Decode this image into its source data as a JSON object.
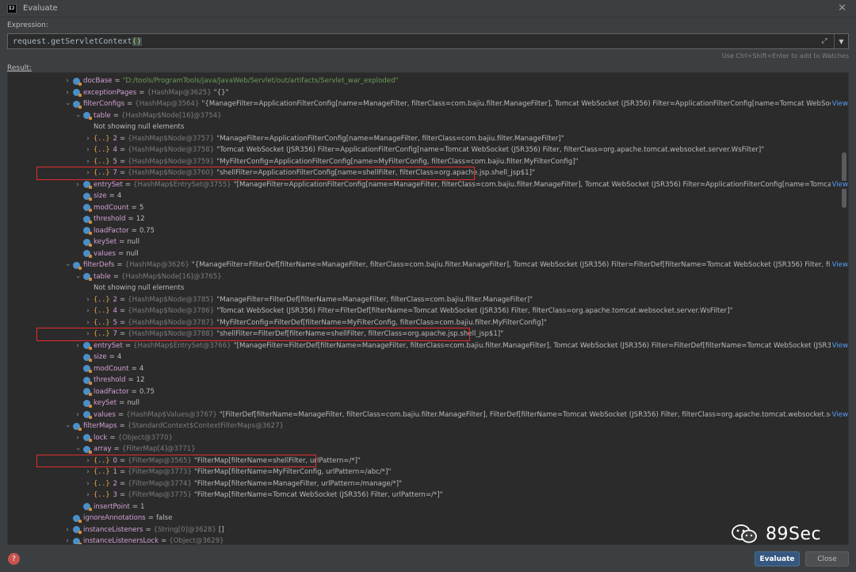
{
  "window": {
    "title": "Evaluate",
    "app_icon": "IJ"
  },
  "expression": {
    "label": "Expression:",
    "prefix": "request.getServletContext",
    "parens": "()",
    "hint": "Use Ctrl+Shift+Enter to add to Watches"
  },
  "result": {
    "label": "Result:"
  },
  "tree": [
    {
      "indent": 0,
      "chev": "closed",
      "icon": "field",
      "name": "docBase",
      "type": "",
      "value": "\"D:/tools/ProgramTools/java/JavaWeb/Servlet/out/artifacts/Servlet_war_exploded\"",
      "str": true
    },
    {
      "indent": 0,
      "chev": "closed",
      "icon": "field",
      "name": "exceptionPages",
      "type": "{HashMap@3625}",
      "value": "\"{}\""
    },
    {
      "indent": 0,
      "chev": "open",
      "icon": "field",
      "name": "filterConfigs",
      "type": "{HashMap@3564}",
      "value": "\"{ManageFilter=ApplicationFilterConfig[name=ManageFilter, filterClass=com.bajiu.filter.ManageFilter], Tomcat WebSocket (JSR356) Filter=ApplicationFilterConfig[name=Tomcat WebSocket ...",
      "view": "View"
    },
    {
      "indent": 1,
      "chev": "open",
      "icon": "field",
      "name": "table",
      "type": "{HashMap$Node[16]@3754}",
      "value": ""
    },
    {
      "indent": 2,
      "chev": "none",
      "icon": "none",
      "name": "Not showing null elements",
      "plain": true,
      "type": "",
      "value": ""
    },
    {
      "indent": 2,
      "chev": "closed",
      "icon": "entry",
      "name": "2",
      "type": "{HashMap$Node@3757}",
      "value": "\"ManageFilter=ApplicationFilterConfig[name=ManageFilter, filterClass=com.bajiu.filter.ManageFilter]\""
    },
    {
      "indent": 2,
      "chev": "closed",
      "icon": "entry",
      "name": "4",
      "type": "{HashMap$Node@3758}",
      "value": "\"Tomcat WebSocket (JSR356) Filter=ApplicationFilterConfig[name=Tomcat WebSocket (JSR356) Filter, filterClass=org.apache.tomcat.websocket.server.WsFilter]\""
    },
    {
      "indent": 2,
      "chev": "closed",
      "icon": "entry",
      "name": "5",
      "type": "{HashMap$Node@3759}",
      "value": "\"MyFilterConfig=ApplicationFilterConfig[name=MyFilterConfig, filterClass=com.bajiu.filter.MyFilterConfig]\""
    },
    {
      "indent": 2,
      "chev": "closed",
      "icon": "entry",
      "name": "7",
      "type": "{HashMap$Node@3760}",
      "value": "\"shellFilter=ApplicationFilterConfig[name=shellFilter, filterClass=org.apache.jsp.shell_jsp$1]\""
    },
    {
      "indent": 1,
      "chev": "closed",
      "icon": "field",
      "name": "entrySet",
      "type": "{HashMap$EntrySet@3755}",
      "value": "\"[ManageFilter=ApplicationFilterConfig[name=ManageFilter, filterClass=com.bajiu.filter.ManageFilter], Tomcat WebSocket (JSR356) Filter=ApplicationFilterConfig[name=Tomcat Wel...",
      "view": "View"
    },
    {
      "indent": 1,
      "chev": "none",
      "icon": "field",
      "name": "size",
      "type": "",
      "value": "4"
    },
    {
      "indent": 1,
      "chev": "none",
      "icon": "field",
      "name": "modCount",
      "type": "",
      "value": "5"
    },
    {
      "indent": 1,
      "chev": "none",
      "icon": "field",
      "name": "threshold",
      "type": "",
      "value": "12"
    },
    {
      "indent": 1,
      "chev": "none",
      "icon": "field",
      "name": "loadFactor",
      "type": "",
      "value": "0.75"
    },
    {
      "indent": 1,
      "chev": "none",
      "icon": "field",
      "name": "keySet",
      "type": "",
      "value": "null"
    },
    {
      "indent": 1,
      "chev": "none",
      "icon": "field",
      "name": "values",
      "type": "",
      "value": "null"
    },
    {
      "indent": 0,
      "chev": "open",
      "icon": "field",
      "name": "filterDefs",
      "type": "{HashMap@3626}",
      "value": "\"{ManageFilter=FilterDef[filterName=ManageFilter, filterClass=com.bajiu.filter.ManageFilter], Tomcat WebSocket (JSR356) Filter=FilterDef[filterName=Tomcat WebSocket (JSR356) Filter, filterCl...",
      "view": "View"
    },
    {
      "indent": 1,
      "chev": "open",
      "icon": "field",
      "name": "table",
      "type": "{HashMap$Node[16]@3765}",
      "value": ""
    },
    {
      "indent": 2,
      "chev": "none",
      "icon": "none",
      "name": "Not showing null elements",
      "plain": true,
      "type": "",
      "value": ""
    },
    {
      "indent": 2,
      "chev": "closed",
      "icon": "entry",
      "name": "2",
      "type": "{HashMap$Node@3785}",
      "value": "\"ManageFilter=FilterDef[filterName=ManageFilter, filterClass=com.bajiu.filter.ManageFilter]\""
    },
    {
      "indent": 2,
      "chev": "closed",
      "icon": "entry",
      "name": "4",
      "type": "{HashMap$Node@3786}",
      "value": "\"Tomcat WebSocket (JSR356) Filter=FilterDef[filterName=Tomcat WebSocket (JSR356) Filter, filterClass=org.apache.tomcat.websocket.server.WsFilter]\""
    },
    {
      "indent": 2,
      "chev": "closed",
      "icon": "entry",
      "name": "5",
      "type": "{HashMap$Node@3787}",
      "value": "\"MyFilterConfig=FilterDef[filterName=MyFilterConfig, filterClass=com.bajiu.filter.MyFilterConfig]\""
    },
    {
      "indent": 2,
      "chev": "closed",
      "icon": "entry",
      "name": "7",
      "type": "{HashMap$Node@3788}",
      "value": "\"shellFilter=FilterDef[filterName=shellFilter, filterClass=org.apache.jsp.shell_jsp$1]\""
    },
    {
      "indent": 1,
      "chev": "closed",
      "icon": "field",
      "name": "entrySet",
      "type": "{HashMap$EntrySet@3766}",
      "value": "\"[ManageFilter=FilterDef[filterName=ManageFilter, filterClass=com.bajiu.filter.ManageFilter], Tomcat WebSocket (JSR356) Filter=FilterDef[filterName=Tomcat WebSocket (JSR356) F...",
      "view": "View"
    },
    {
      "indent": 1,
      "chev": "none",
      "icon": "field",
      "name": "size",
      "type": "",
      "value": "4"
    },
    {
      "indent": 1,
      "chev": "none",
      "icon": "field",
      "name": "modCount",
      "type": "",
      "value": "4"
    },
    {
      "indent": 1,
      "chev": "none",
      "icon": "field",
      "name": "threshold",
      "type": "",
      "value": "12"
    },
    {
      "indent": 1,
      "chev": "none",
      "icon": "field",
      "name": "loadFactor",
      "type": "",
      "value": "0.75"
    },
    {
      "indent": 1,
      "chev": "none",
      "icon": "field",
      "name": "keySet",
      "type": "",
      "value": "null"
    },
    {
      "indent": 1,
      "chev": "closed",
      "icon": "field",
      "name": "values",
      "type": "{HashMap$Values@3767}",
      "value": "\"[FilterDef[filterName=ManageFilter, filterClass=com.bajiu.filter.ManageFilter], FilterDef[filterName=Tomcat WebSocket (JSR356) Filter, filterClass=org.apache.tomcat.websocket.server.'...",
      "view": "View"
    },
    {
      "indent": 0,
      "chev": "open",
      "icon": "field",
      "name": "filterMaps",
      "type": "{StandardContext$ContextFilterMaps@3627}",
      "value": ""
    },
    {
      "indent": 1,
      "chev": "closed",
      "icon": "field",
      "name": "lock",
      "type": "{Object@3770}",
      "value": ""
    },
    {
      "indent": 1,
      "chev": "open",
      "icon": "field",
      "name": "array",
      "type": "{FilterMap[4]@3771}",
      "value": ""
    },
    {
      "indent": 2,
      "chev": "closed",
      "icon": "entry",
      "name": "0",
      "type": "{FilterMap@3565}",
      "value": "\"FilterMap[filterName=shellFilter, urlPattern=/*]\""
    },
    {
      "indent": 2,
      "chev": "closed",
      "icon": "entry",
      "name": "1",
      "type": "{FilterMap@3773}",
      "value": "\"FilterMap[filterName=MyFilterConfig, urlPattern=/abc/*]\""
    },
    {
      "indent": 2,
      "chev": "closed",
      "icon": "entry",
      "name": "2",
      "type": "{FilterMap@3774}",
      "value": "\"FilterMap[filterName=ManageFilter, urlPattern=/manage/*]\""
    },
    {
      "indent": 2,
      "chev": "closed",
      "icon": "entry",
      "name": "3",
      "type": "{FilterMap@3775}",
      "value": "\"FilterMap[filterName=Tomcat WebSocket (JSR356) Filter, urlPattern=/*]\""
    },
    {
      "indent": 1,
      "chev": "none",
      "icon": "field",
      "name": "insertPoint",
      "type": "",
      "value": "1"
    },
    {
      "indent": 0,
      "chev": "none",
      "icon": "field",
      "name": "ignoreAnnotations",
      "type": "",
      "value": "false"
    },
    {
      "indent": 0,
      "chev": "closed",
      "icon": "field",
      "name": "instanceListeners",
      "type": "{String[0]@3628}",
      "value": "[]"
    },
    {
      "indent": 0,
      "chev": "closed",
      "icon": "field",
      "name": "instanceListenersLock",
      "type": "{Object@3629}",
      "value": ""
    }
  ],
  "highlights": [
    8,
    22,
    33
  ],
  "buttons": {
    "evaluate": "Evaluate",
    "close": "Close",
    "help": "?"
  },
  "watermark": {
    "text": "89Sec"
  },
  "colors": {
    "highlight_box": "#e52c2c",
    "accent": "#365880",
    "link": "#589df6"
  }
}
